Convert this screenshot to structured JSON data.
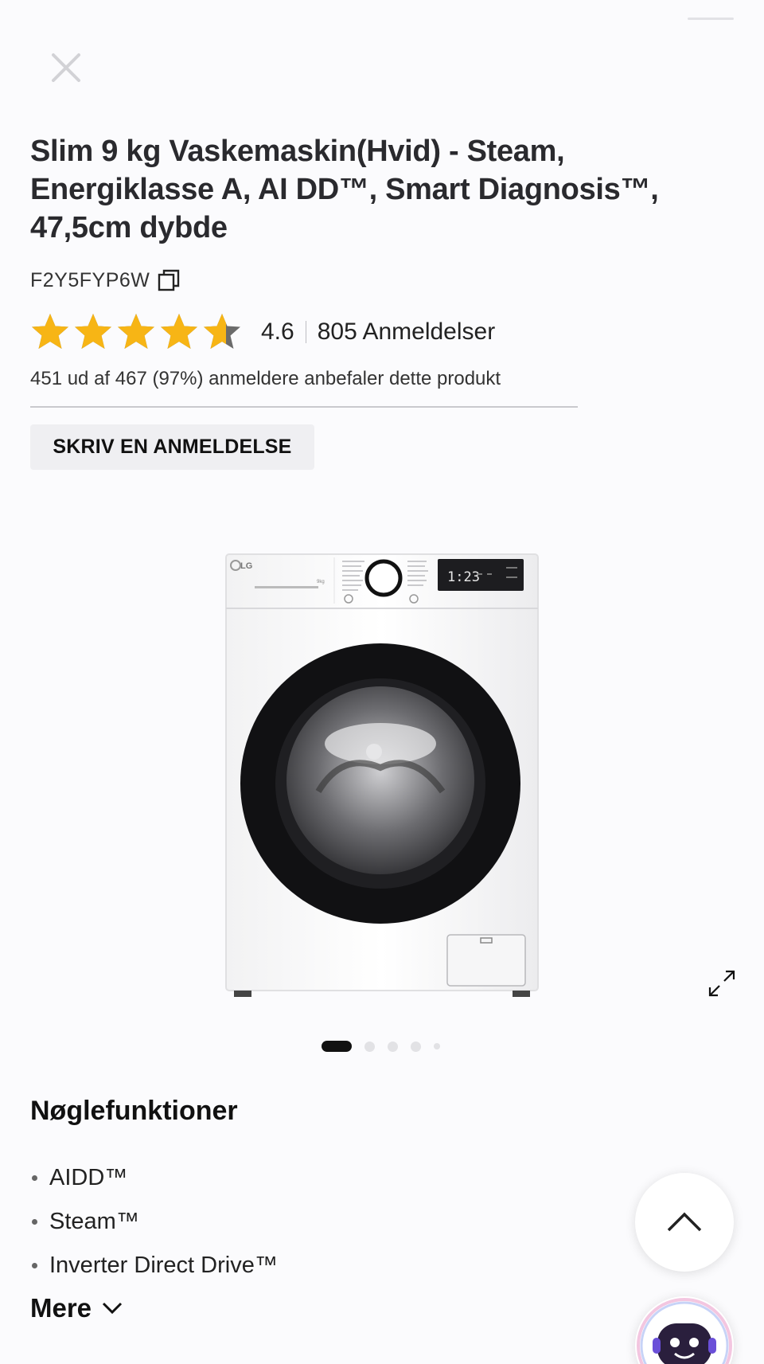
{
  "product": {
    "title": "Slim 9 kg Vaskemaskin(Hvid) - Steam, Energiklasse A, AI DD™, Smart Diagnosis™, 47,5cm dybde",
    "model_code": "F2Y5FYP6W",
    "rating": "4.6",
    "rating_value": 4.6,
    "rating_max": 5,
    "reviews_label": "805 Anmeldelser",
    "recommend_text": "451 ud af 467 (97%) anmeldere anbefaler dette produkt",
    "write_review_label": "SKRIV EN ANMELDELSE",
    "image_brand": "LG",
    "image_display": "1:23",
    "image_capacity": "9kg"
  },
  "carousel": {
    "slide_count": 5,
    "active_index": 0
  },
  "features": {
    "heading": "Nøglefunktioner",
    "items": [
      "AIDD™",
      "Steam™",
      "Inverter Direct Drive™"
    ],
    "more_label": "Mere"
  },
  "colors": {
    "star": "#f7b515",
    "star_empty": "#6b6b6b",
    "text": "#1b1b1f",
    "button_bg": "#efeff2"
  },
  "icons": {
    "close": "close-icon",
    "copy": "copy-icon",
    "expand": "expand-icon",
    "scroll_top": "chevron-up-icon",
    "more": "chevron-down-icon",
    "chatbot": "chatbot-icon"
  }
}
